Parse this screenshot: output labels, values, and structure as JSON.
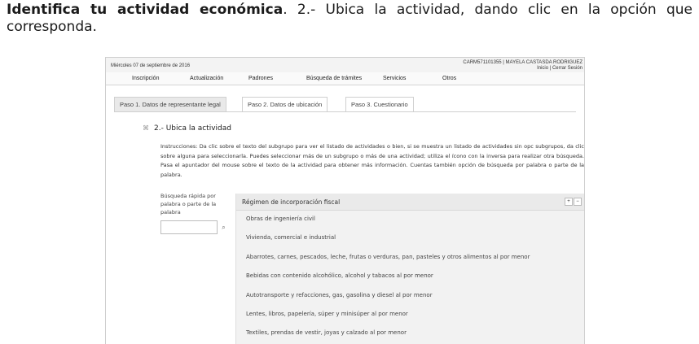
{
  "heading": {
    "bold": "Identifica tu actividad económica",
    "rest": ". 2.- Ubica la actividad, dando clic en la opción que corresponda."
  },
  "topbar": {
    "date": "Miércoles 07 de septiembre de 2016",
    "user": "CARM571101355 | MAYELA CASTASDA RODRIGUEZ",
    "links": "Inicio | Cerrar Sesión"
  },
  "menu": [
    "Inscripción",
    "Actualización",
    "Padrones",
    "Búsqueda de trámites",
    "Servicios",
    "Otros"
  ],
  "tabs": [
    {
      "label": "Paso 1. Datos de representante legal",
      "active": true
    },
    {
      "label": "Paso 2. Datos de ubicación",
      "active": false
    },
    {
      "label": "Paso 3. Cuestionario",
      "active": false
    }
  ],
  "section": {
    "toggle": "⌘",
    "title": "2.- Ubica la actividad",
    "instructions": "Instrucciones: Da clic sobre el texto del subgrupo para ver el listado de actividades o bien, si se muestra un listado de actividades sin opc subgrupos, da clic sobre alguna para seleccionarla. Puedes seleccionar más de un subgrupo o más de una actividad; utiliza el ícono con la inversa para realizar otra búsqueda. Pasa el apuntador del mouse sobre el texto de la actividad para obtener más información. Cuentas también opción de búsqueda por palabra o parte de la palabra."
  },
  "search": {
    "label": "Búsqueda rápida por palabra o parte de la palabra",
    "value": "",
    "icon": "search-icon"
  },
  "panel": {
    "title": "Régimen de incorporación fiscal",
    "controls": [
      "+",
      "−"
    ],
    "items": [
      "Obras de ingeniería civil",
      "Vivienda, comercial e industrial",
      "Abarrotes, carnes, pescados, leche, frutas o verduras, pan, pasteles y otros alimentos al por menor",
      "Bebidas con contenido alcohólico, alcohol y tabacos al por menor",
      "Autotransporte y refacciones, gas, gasolina y diesel al por menor",
      "Lentes, libros, papelería, súper y minisúper al por menor",
      "Textiles, prendas de vestir, joyas y calzado al por menor"
    ]
  }
}
